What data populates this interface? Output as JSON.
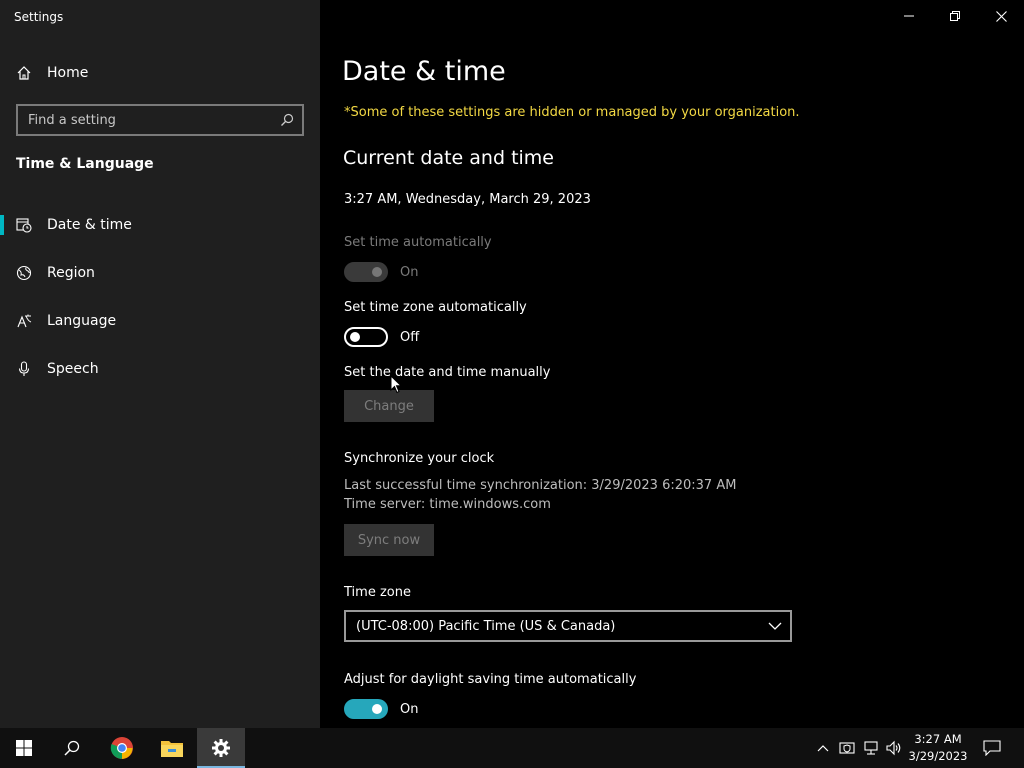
{
  "window": {
    "title": "Settings",
    "controls": [
      "minimize-icon",
      "restore-icon",
      "close-icon"
    ]
  },
  "sidebar": {
    "home_label": "Home",
    "search_placeholder": "Find a setting",
    "section_title": "Time & Language",
    "items": [
      {
        "label": "Date & time",
        "icon": "clock-calendar-icon",
        "active": true
      },
      {
        "label": "Region",
        "icon": "globe-icon",
        "active": false
      },
      {
        "label": "Language",
        "icon": "language-icon",
        "active": false
      },
      {
        "label": "Speech",
        "icon": "microphone-icon",
        "active": false
      }
    ]
  },
  "main": {
    "title": "Date & time",
    "managed_notice": "*Some of these settings are hidden or managed by your organization.",
    "current_heading": "Current date and time",
    "current_value": "3:27 AM, Wednesday, March 29, 2023",
    "set_time_auto": {
      "label": "Set time automatically",
      "state": "On",
      "enabled": false
    },
    "set_zone_auto": {
      "label": "Set time zone automatically",
      "state": "Off",
      "enabled": true
    },
    "manual": {
      "label": "Set the date and time manually",
      "button": "Change"
    },
    "sync": {
      "heading": "Synchronize your clock",
      "last_sync": "Last successful time synchronization: 3/29/2023 6:20:37 AM",
      "server": "Time server: time.windows.com",
      "button": "Sync now"
    },
    "timezone": {
      "label": "Time zone",
      "value": "(UTC-08:00) Pacific Time (US & Canada)"
    },
    "daylight": {
      "label": "Adjust for daylight saving time automatically",
      "state": "On",
      "enabled": true
    }
  },
  "taskbar": {
    "apps": [
      "windows-start-icon",
      "search-icon",
      "chrome-icon",
      "file-explorer-icon",
      "settings-gear-icon"
    ],
    "tray_icons": [
      "chevron-up-icon",
      "defender-icon",
      "network-icon",
      "volume-icon",
      "notification-icon"
    ],
    "time": "3:27 AM",
    "date": "3/29/2023"
  },
  "colors": {
    "accent": "#00b7c3",
    "toggle_on": "#26a7bb",
    "notice": "#f3d944",
    "sidebar_bg": "#1f1f1f"
  }
}
